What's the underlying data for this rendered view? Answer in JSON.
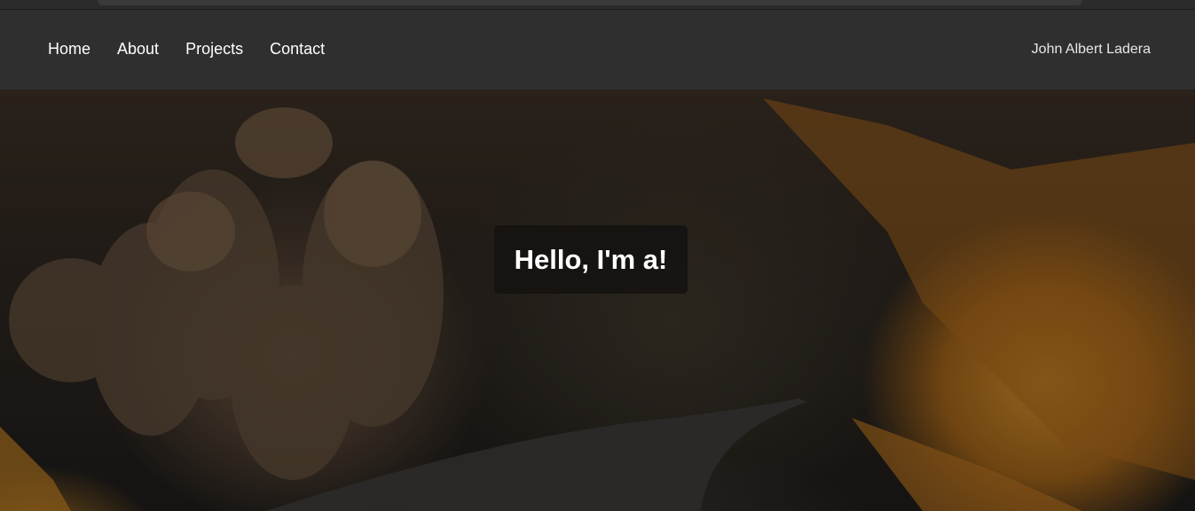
{
  "nav": {
    "links": [
      {
        "label": "Home"
      },
      {
        "label": "About"
      },
      {
        "label": "Projects"
      },
      {
        "label": "Contact"
      }
    ],
    "brand": "John Albert Ladera"
  },
  "hero": {
    "headline": "Hello, I'm a!"
  }
}
